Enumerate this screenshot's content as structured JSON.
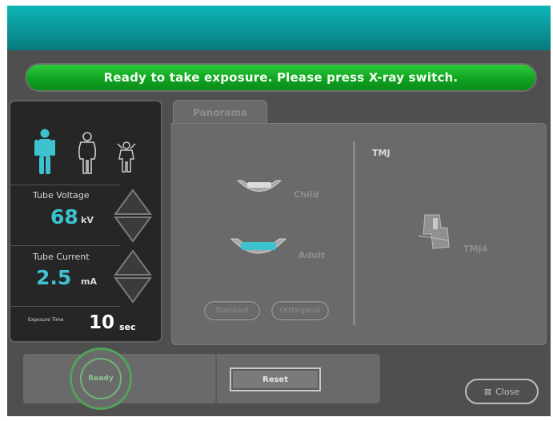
{
  "status": {
    "message": "Ready to take exposure. Please press X-ray switch."
  },
  "patient_types": [
    "adult-figure-selected",
    "large-figure",
    "child-figure"
  ],
  "tube_voltage": {
    "label": "Tube Voltage",
    "value": "68",
    "unit": "kV"
  },
  "tube_current": {
    "label": "Tube Current",
    "value": "2.5",
    "unit": "mA"
  },
  "exposure_time": {
    "label": "Exposure Time",
    "value": "10",
    "unit": "sec"
  },
  "tabs": [
    {
      "label": "Panorama"
    }
  ],
  "panorama": {
    "child_label": "Child",
    "adult_label": "Adult",
    "button1": "Standard",
    "button2": "Orthogonal"
  },
  "tmj": {
    "title": "TMJ",
    "option_label": "TMJ4"
  },
  "bottom": {
    "ready_label": "Ready",
    "reset_label": "Reset",
    "close_label": "Close"
  },
  "colors": {
    "accent": "#3cc3cf",
    "status_green": "#10a021",
    "topbar": "#0a8c90"
  }
}
